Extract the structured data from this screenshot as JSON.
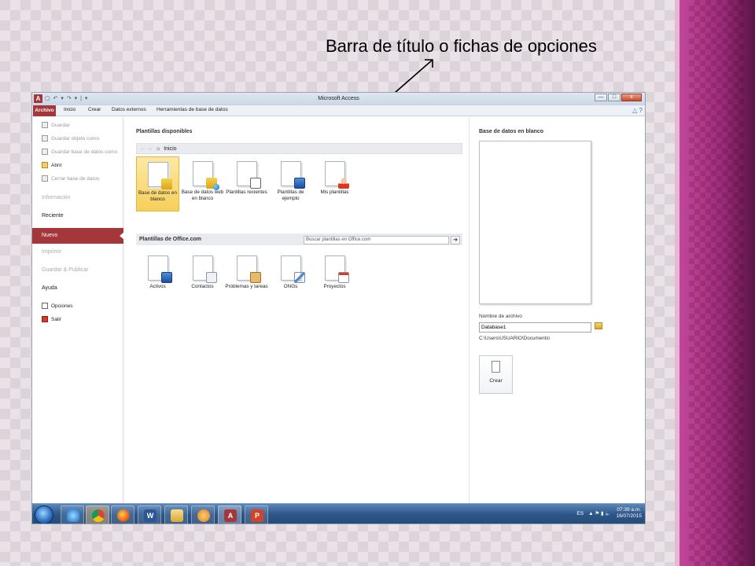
{
  "slide": {
    "title": "Barra de título o fichas de opciones"
  },
  "window": {
    "title": "Microsoft Access",
    "app_badge": "A",
    "qat": "▢ ↶ ▾ ↷ ▾ | ▾",
    "controls": {
      "minimize": "—",
      "maximize": "□",
      "close": "x"
    }
  },
  "ribbon": {
    "tabs": [
      "Archivo",
      "Inicio",
      "Crear",
      "Datos externos",
      "Herramientas de base de datos"
    ],
    "help_icons": "△ ?"
  },
  "backstage": {
    "menu_small": [
      "Guardar",
      "Guardar objeto como",
      "Guardar base de datos como",
      "Abrir",
      "Cerrar base de datos"
    ],
    "menu_large": {
      "informacion": "Información",
      "reciente": "Reciente",
      "nuevo": "Nuevo",
      "imprimir": "Imprimir",
      "guardar_publicar": "Guardar & Publicar",
      "ayuda": "Ayuda"
    },
    "menu_bottom": [
      "Opciones",
      "Salir"
    ]
  },
  "templates": {
    "heading": "Plantillas disponibles",
    "breadcrumb_nav": "← →",
    "breadcrumb": "Inicio",
    "items": [
      {
        "label": "Base de datos en blanco",
        "icon": "database-icon",
        "selected": true
      },
      {
        "label": "Base de datos web en blanco",
        "icon": "web-database-icon",
        "selected": false
      },
      {
        "label": "Plantillas recientes",
        "icon": "clock-icon",
        "selected": false
      },
      {
        "label": "Plantillas de ejemplo",
        "icon": "monitor-icon",
        "selected": false
      },
      {
        "label": "Mis plantillas",
        "icon": "person-icon",
        "selected": false
      }
    ],
    "office_heading": "Plantillas de Office.com",
    "search_placeholder": "Buscar plantillas en Office.com",
    "search_button": "➜",
    "office_items": [
      {
        "label": "Activos",
        "icon": "monitor-icon"
      },
      {
        "label": "Contactos",
        "icon": "contact-card-icon"
      },
      {
        "label": "Problemas y tareas",
        "icon": "clipboard-icon"
      },
      {
        "label": "ONGs",
        "icon": "pencil-icon"
      },
      {
        "label": "Proyectos",
        "icon": "calendar-icon"
      }
    ]
  },
  "blank_db": {
    "heading": "Base de datos en blanco",
    "filename_label": "Nombre de archivo",
    "filename_value": "Database1",
    "path": "C:\\Users\\USUARIO\\Documents\\",
    "create_label": "Crear"
  },
  "taskbar": {
    "lang": "ES",
    "tray_icons": "▲ ⚑ ▮ 🔈",
    "time": "07:39 a.m.",
    "date": "16/07/2015",
    "apps": [
      "internet-explorer-icon",
      "chrome-icon",
      "firefox-icon",
      "word-icon",
      "folder-icon",
      "media-player-icon",
      "access-icon",
      "powerpoint-icon"
    ]
  }
}
